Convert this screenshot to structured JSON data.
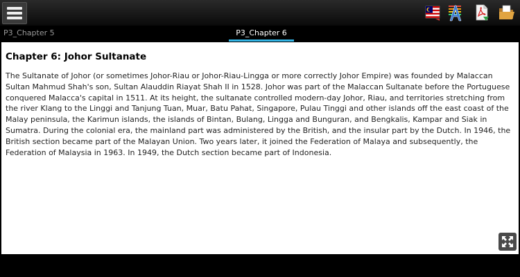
{
  "toolbar": {
    "menu_icon": "hamburger-menu-icon",
    "icons": [
      "flag-translate-icon",
      "font-size-icon",
      "pdf-export-icon",
      "open-folder-icon"
    ]
  },
  "tabs": {
    "previous": "P3_Chapter 5",
    "current": "P3_Chapter 6"
  },
  "article": {
    "title": "Chapter 6: Johor Sultanate",
    "body": "The Sultanate of Johor (or sometimes Johor-Riau or Johor-Riau-Lingga or more correctly Johor Empire) was founded by Malaccan Sultan Mahmud Shah's son, Sultan Alauddin Riayat Shah II in 1528. Johor was part of the Malaccan Sultanate before the Portuguese conquered Malacca's capital in 1511. At its height, the sultanate controlled modern-day Johor, Riau, and territories stretching from the river Klang to the Linggi and Tanjung Tuan, Muar, Batu Pahat, Singapore, Pulau Tinggi and other islands off the east coast of the Malay peninsula, the Karimun islands, the islands of Bintan, Bulang, Lingga and Bunguran, and Bengkalis, Kampar and Siak in Sumatra. During the colonial era, the mainland part was administered by the British, and the insular part by the Dutch. In 1946, the British section became part of the Malayan Union. Two years later, it joined the Federation of Malaya and subsequently, the Federation of Malaysia in 1963. In 1949, the Dutch section became part of Indonesia."
  },
  "controls": {
    "fullscreen_icon": "fullscreen-expand-icon"
  },
  "colors": {
    "accent": "#33b5e5",
    "toolbar": "#1a1a1a",
    "content_bg": "#ffffff"
  }
}
